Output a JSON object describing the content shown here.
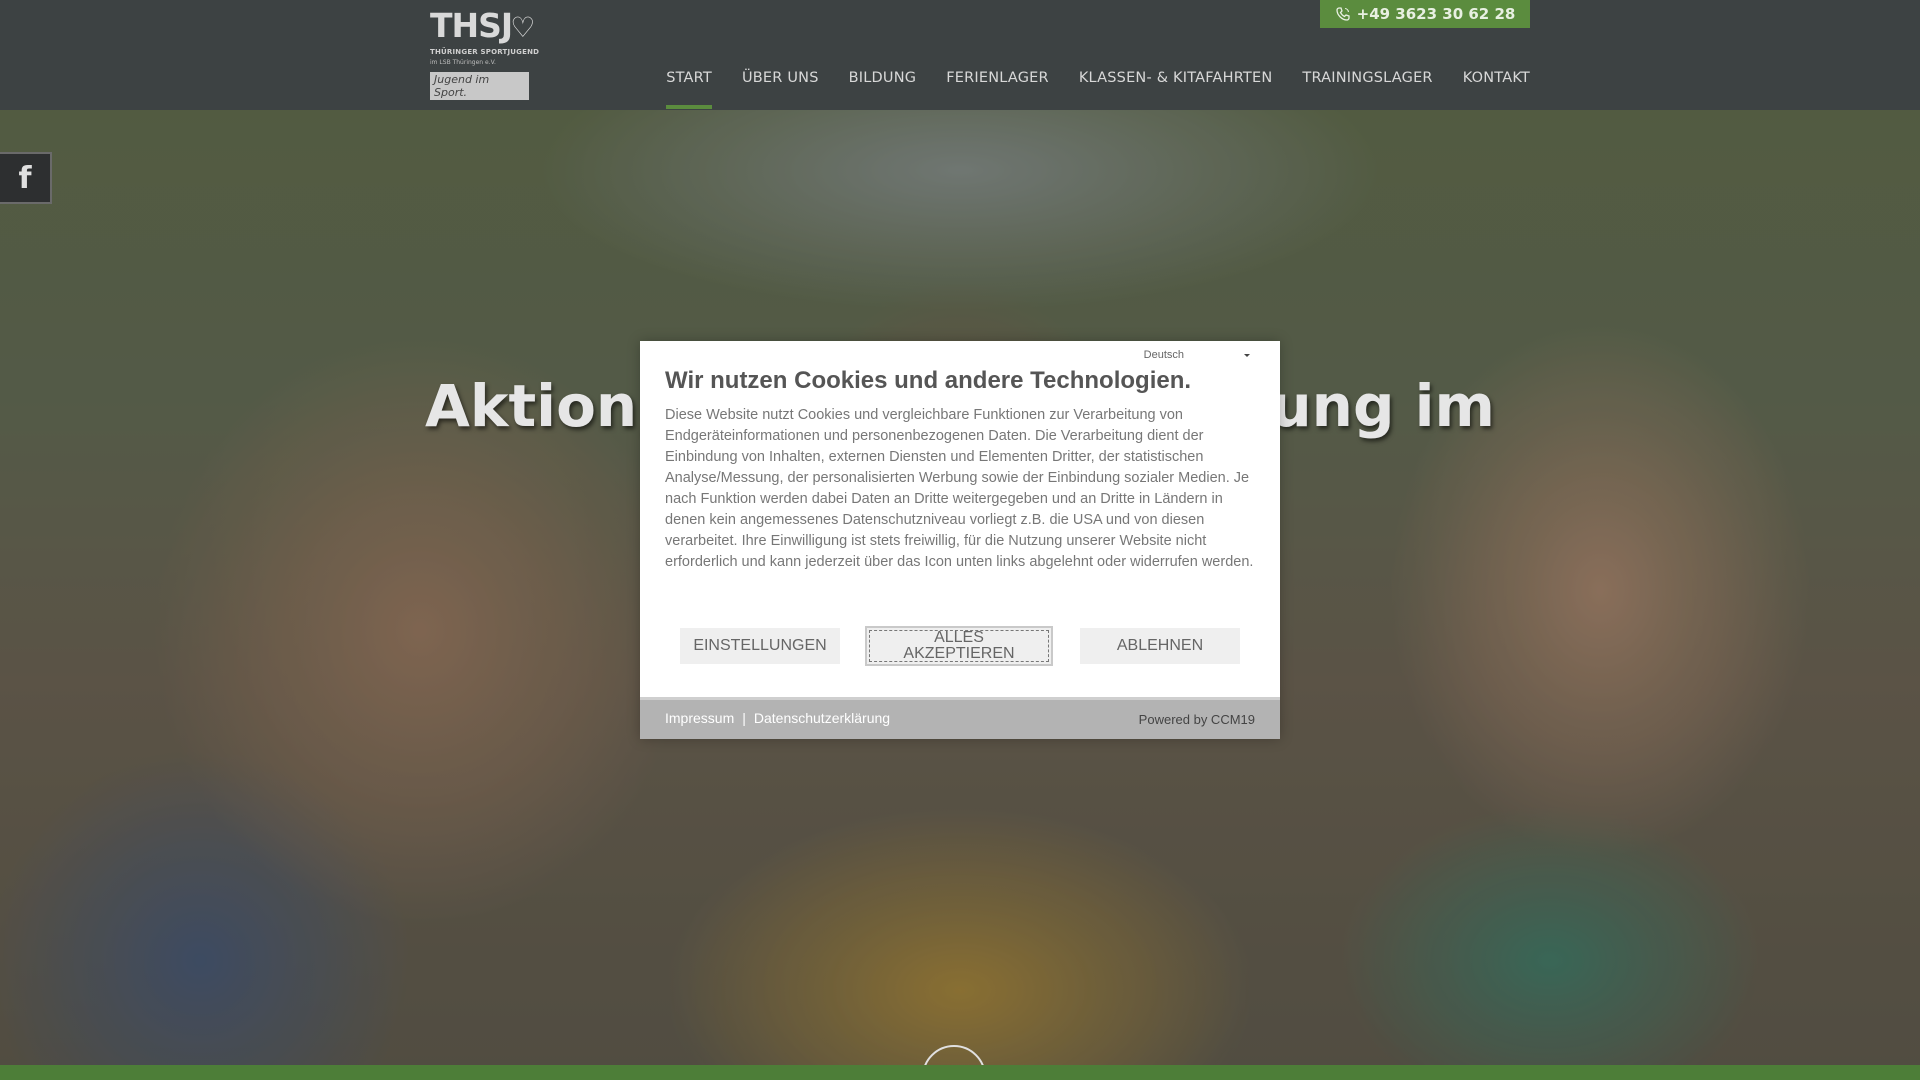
{
  "header": {
    "logo": {
      "name": "THSJ",
      "subtitle": "THÜRINGER SPORTJUGEND",
      "org": "im LSB Thüringen e.V.",
      "tagline": "Jugend im Sport."
    },
    "phone": "+49 3623 30 62 28",
    "nav": [
      {
        "label": "START",
        "active": true
      },
      {
        "label": "ÜBER UNS"
      },
      {
        "label": "BILDUNG"
      },
      {
        "label": "FERIENLAGER"
      },
      {
        "label": "KLASSEN- & KITAFAHRTEN"
      },
      {
        "label": "TRAININGSLAGER"
      },
      {
        "label": "KONTAKT"
      }
    ]
  },
  "hero": {
    "title_left": "Aktion,",
    "title_right": "rung im"
  },
  "social": {
    "facebook": "f"
  },
  "cookie": {
    "language": "Deutsch",
    "title": "Wir nutzen Cookies und andere Technologien.",
    "text": "Diese Website nutzt Cookies und vergleichbare Funktionen zur Verarbeitung von Endgeräteinformationen und personenbezogenen Daten. Die Verarbeitung dient der Einbindung von Inhalten, externen Diensten und Elementen Dritter, der statistischen Analyse/Messung, der personalisierten Werbung sowie der Einbindung sozialer Medien. Je nach Funktion werden dabei Daten an Dritte weitergegeben und an Dritte in Ländern in denen kein angemessenes Datenschutzniveau vorliegt z.B. die USA und von diesen verarbeitet. Ihre Einwilligung ist stets freiwillig, für die Nutzung unserer Website nicht erforderlich und kann jederzeit über das Icon unten links abgelehnt oder widerrufen werden.",
    "btn_settings": "EINSTELLUNGEN",
    "btn_accept_line1": "ALLES",
    "btn_accept_line2": "AKZEPTIEREN",
    "btn_decline": "ABLEHNEN",
    "link_impressum": "Impressum",
    "separator": "|",
    "link_privacy": "Datenschutzerklärung",
    "powered": "Powered by CCM19"
  }
}
